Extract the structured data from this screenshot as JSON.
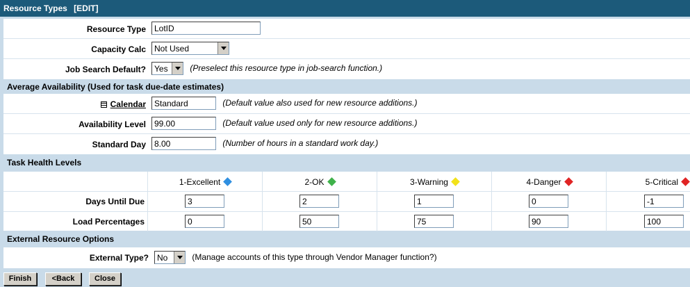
{
  "header": {
    "title": "Resource Types",
    "mode": "[EDIT]"
  },
  "resource_type": {
    "label": "Resource Type",
    "value": "LotID"
  },
  "capacity_calc": {
    "label": "Capacity Calc",
    "value": "Not Used"
  },
  "job_search": {
    "label": "Job Search Default?",
    "value": "Yes",
    "hint": "(Preselect this resource type in job-search function.)"
  },
  "availability_section": {
    "title": "Average Availability (Used for task due-date estimates)"
  },
  "calendar": {
    "label": "Calendar",
    "value": "Standard",
    "hint": "(Default value also used for new resource additions.)",
    "icon": "list-icon"
  },
  "availability_level": {
    "label": "Availability Level",
    "value": "99.00",
    "hint": "(Default value used only for new resource additions.)"
  },
  "standard_day": {
    "label": "Standard Day",
    "value": "8.00",
    "hint": "(Number of hours in a standard work day.)"
  },
  "health_section": {
    "title": "Task Health Levels"
  },
  "health": {
    "levels": [
      {
        "name": "1-Excellent",
        "color": "#2f8fe0"
      },
      {
        "name": "2-OK",
        "color": "#3fb24a"
      },
      {
        "name": "3-Warning",
        "color": "#f2e21a"
      },
      {
        "name": "4-Danger",
        "color": "#e02424"
      },
      {
        "name": "5-Critical",
        "color": "#e02424"
      }
    ],
    "days_label": "Days Until Due",
    "days": [
      "3",
      "2",
      "1",
      "0",
      "-1"
    ],
    "load_label": "Load Percentages",
    "load": [
      "0",
      "50",
      "75",
      "90",
      "100"
    ]
  },
  "external_section": {
    "title": "External Resource Options"
  },
  "external_type": {
    "label": "External Type?",
    "value": "No",
    "hint": "(Manage accounts of this type through Vendor Manager function?)"
  },
  "buttons": {
    "finish": "Finish",
    "back": "<Back",
    "close": "Close"
  }
}
